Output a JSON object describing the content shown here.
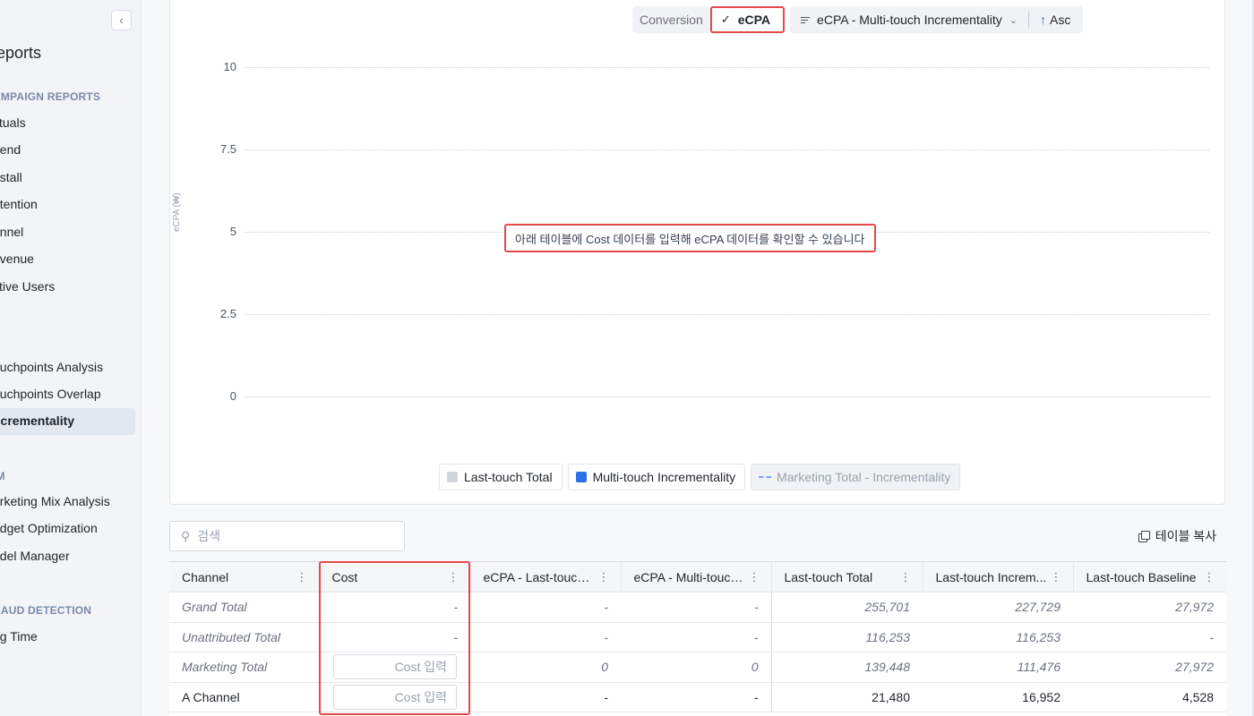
{
  "sidebar": {
    "collapse_icon": "chevron-left-icon",
    "collapse_glyph": "‹",
    "title": "eports",
    "sections": [
      {
        "label": "AMPAIGN REPORTS"
      },
      {
        "label": "A"
      },
      {
        "label": "IM"
      },
      {
        "label": "RAUD DETECTION"
      }
    ],
    "items": [
      {
        "label": "ctuals"
      },
      {
        "label": "pend"
      },
      {
        "label": "nstall"
      },
      {
        "label": "etention"
      },
      {
        "label": "unnel"
      },
      {
        "label": "evenue"
      },
      {
        "label": "ctive Users"
      },
      {
        "label": "ouchpoints Analysis"
      },
      {
        "label": "ouchpoints Overlap"
      },
      {
        "label": "ncrementality",
        "active": true
      },
      {
        "label": "arketing Mix Analysis"
      },
      {
        "label": "udget Optimization"
      },
      {
        "label": "odel Manager"
      },
      {
        "label": "ng Time"
      }
    ]
  },
  "toolbar": {
    "metric_tabs": [
      {
        "label": "Conversion",
        "active": false
      },
      {
        "label": "eCPA",
        "active": true,
        "check": "✓"
      }
    ],
    "sort_by": "eCPA - Multi-touch Incrementality",
    "sort_dropdown_glyph": "⌄",
    "sort_order": "Asc",
    "sort_order_arrow": "↑"
  },
  "chart_data": {
    "type": "bar",
    "ylabel": "eCPA (₩)",
    "ylim": [
      0,
      10
    ],
    "y_ticks": [
      "10",
      "7.5",
      "5",
      "2.5",
      "0"
    ],
    "categories": [],
    "series": [
      {
        "name": "Last-touch Total",
        "color": "#d1d5db",
        "values": []
      },
      {
        "name": "Multi-touch Incrementality",
        "color": "#2f6fe8",
        "values": []
      },
      {
        "name": "Marketing Total - Incrementality",
        "color": "#7b9ff0",
        "style": "dashed",
        "values": [],
        "hidden": true
      }
    ],
    "grid": true,
    "legend_position": "bottom-center",
    "empty_message": "아래 테이블에 Cost 데이터를 입력해 eCPA 데이터를 확인할 수 있습니다"
  },
  "search": {
    "placeholder": "검색",
    "icon": "search-icon",
    "glyph": "⚲"
  },
  "copy_table": {
    "label": "테이블 복사",
    "icon": "copy-icon"
  },
  "table": {
    "kebab_glyph": "⋮",
    "columns": [
      "Channel",
      "Cost",
      "eCPA - Last-touch ...",
      "eCPA - Multi-touch...",
      "Last-touch Total",
      "Last-touch Increm...",
      "Last-touch Baseline"
    ],
    "cost_placeholder": "Cost 입력",
    "rows": [
      {
        "channel": "Grand Total",
        "cost": "-",
        "ecpa_lt": "-",
        "ecpa_mt": "-",
        "lt_total": "255,701",
        "lt_incr": "227,729",
        "lt_base": "27,972"
      },
      {
        "channel": "Unattributed Total",
        "cost": "-",
        "ecpa_lt": "-",
        "ecpa_mt": "-",
        "lt_total": "116,253",
        "lt_incr": "116,253",
        "lt_base": "-"
      },
      {
        "channel": "Marketing Total",
        "cost": "",
        "ecpa_lt": "0",
        "ecpa_mt": "0",
        "lt_total": "139,448",
        "lt_incr": "111,476",
        "lt_base": "27,972"
      },
      {
        "channel": "A Channel",
        "cost": "",
        "ecpa_lt": "-",
        "ecpa_mt": "-",
        "lt_total": "21,480",
        "lt_incr": "16,952",
        "lt_base": "4,528"
      }
    ]
  },
  "colors": {
    "highlight": "#e5484d",
    "accent_blue": "#2f6fe8",
    "sidebar_bg": "#f2f4f7"
  }
}
